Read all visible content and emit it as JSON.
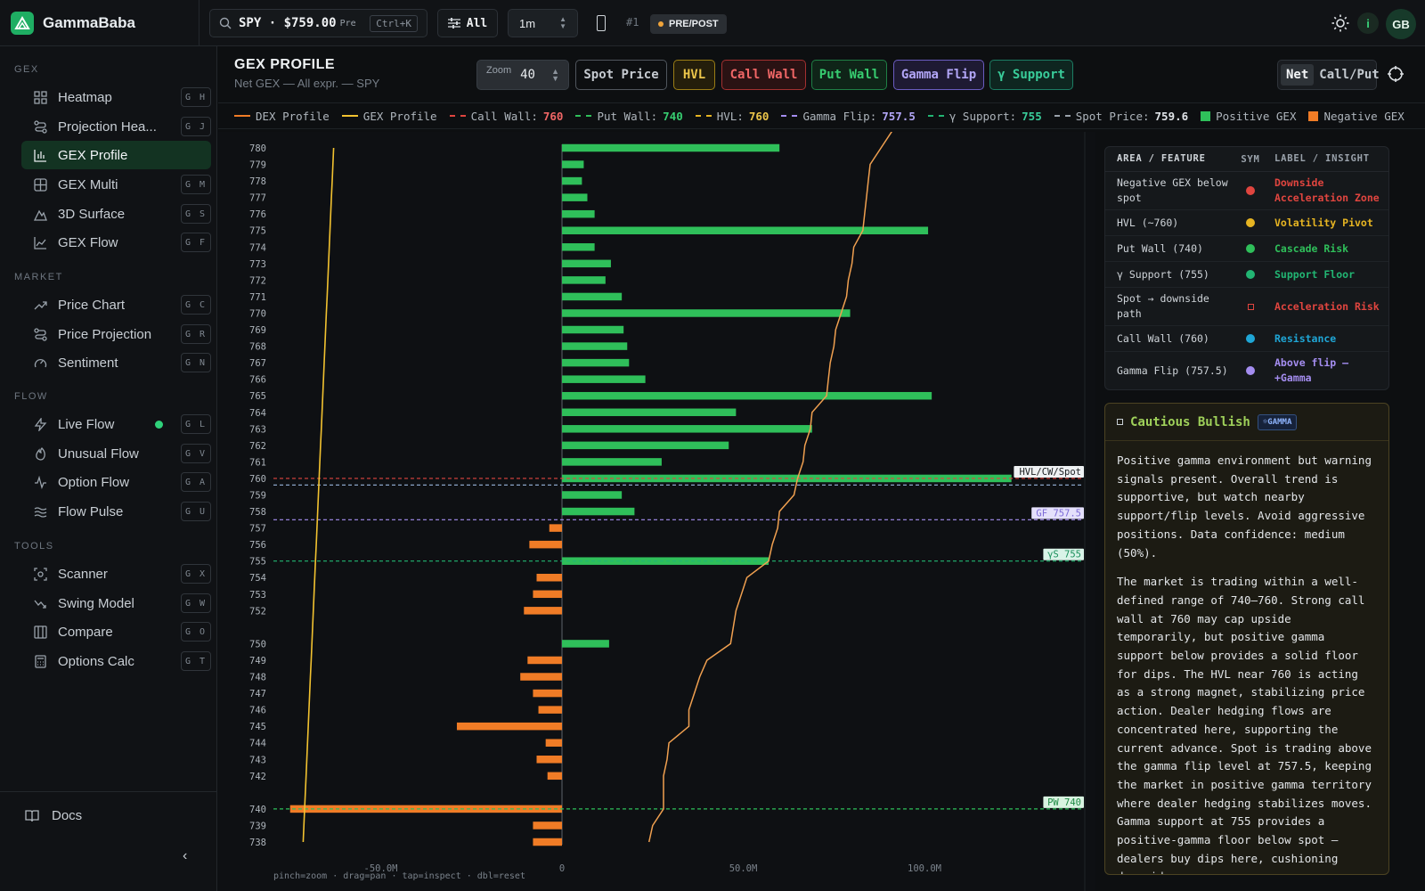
{
  "app": {
    "name": "GammaBaba"
  },
  "topbar": {
    "ticker_text": "SPY · $759.00",
    "ticker_tag": "Pre",
    "search_shortcut": "Ctrl+K",
    "filter_label": "All",
    "interval": "1m",
    "sequence": "#1",
    "session_badge": "PRE/POST",
    "info_label": "i",
    "avatar_initials": "GB"
  },
  "sidebar": {
    "sections": [
      {
        "title": "GEX",
        "items": [
          {
            "label": "Heatmap",
            "shortcut": "G H",
            "icon": "grid-icon"
          },
          {
            "label": "Projection Hea...",
            "shortcut": "G J",
            "icon": "projection-icon"
          },
          {
            "label": "GEX Profile",
            "shortcut": "",
            "icon": "bar-chart-icon",
            "active": true
          },
          {
            "label": "GEX Multi",
            "shortcut": "G M",
            "icon": "grid-plus-icon"
          },
          {
            "label": "3D Surface",
            "shortcut": "G S",
            "icon": "mountain-icon"
          },
          {
            "label": "GEX Flow",
            "shortcut": "G F",
            "icon": "line-chart-icon"
          }
        ]
      },
      {
        "title": "MARKET",
        "items": [
          {
            "label": "Price Chart",
            "shortcut": "G C",
            "icon": "trending-icon"
          },
          {
            "label": "Price Projection",
            "shortcut": "G R",
            "icon": "projection-icon"
          },
          {
            "label": "Sentiment",
            "shortcut": "G N",
            "icon": "gauge-icon"
          }
        ]
      },
      {
        "title": "FLOW",
        "items": [
          {
            "label": "Live Flow",
            "shortcut": "G L",
            "icon": "bolt-icon",
            "live": true
          },
          {
            "label": "Unusual Flow",
            "shortcut": "G V",
            "icon": "flame-icon"
          },
          {
            "label": "Option Flow",
            "shortcut": "G A",
            "icon": "pulse-icon"
          },
          {
            "label": "Flow Pulse",
            "shortcut": "G U",
            "icon": "waves-icon"
          }
        ]
      },
      {
        "title": "TOOLS",
        "items": [
          {
            "label": "Scanner",
            "shortcut": "G X",
            "icon": "scan-icon"
          },
          {
            "label": "Swing Model",
            "shortcut": "G W",
            "icon": "swing-icon"
          },
          {
            "label": "Compare",
            "shortcut": "G O",
            "icon": "columns-icon"
          },
          {
            "label": "Options Calc",
            "shortcut": "G T",
            "icon": "calculator-icon"
          }
        ]
      }
    ],
    "docs_label": "Docs"
  },
  "header": {
    "title": "GEX PROFILE",
    "subtitle": "Net GEX — All expr. — SPY",
    "zoom_label": "Zoom",
    "zoom_value": "40",
    "toggles": {
      "spot": "Spot Price",
      "hvl": "HVL",
      "call_wall": "Call Wall",
      "put_wall": "Put Wall",
      "gamma_flip": "Gamma Flip",
      "gamma_support": "γ Support"
    },
    "mode_on": "Net",
    "mode_off": "Call/Put"
  },
  "legend": {
    "dex": "DEX Profile",
    "gex": "GEX Profile",
    "call_wall": "Call Wall:",
    "call_wall_val": "760",
    "put_wall": "Put Wall:",
    "put_wall_val": "740",
    "hvl": "HVL:",
    "hvl_val": "760",
    "gamma_flip": "Gamma Flip:",
    "gamma_flip_val": "757.5",
    "gamma_support": "γ Support:",
    "gamma_support_val": "755",
    "spot": "Spot Price:",
    "spot_val": "759.6",
    "pos": "Positive GEX",
    "neg": "Negative GEX"
  },
  "chart_data": {
    "type": "bar",
    "orientation": "horizontal",
    "x_ticks": [
      "-50.0M",
      "0",
      "50.0M",
      "100.0M"
    ],
    "xlim": [
      -75,
      140
    ],
    "y_unit": "strike",
    "strikes": [
      780,
      779,
      778,
      777,
      776,
      775,
      774,
      773,
      772,
      771,
      770,
      769,
      768,
      767,
      766,
      765,
      764,
      763,
      762,
      761,
      760,
      759,
      758,
      757,
      756,
      755,
      754,
      753,
      752,
      750,
      749,
      748,
      747,
      746,
      745,
      744,
      743,
      742,
      740,
      739,
      738
    ],
    "net_gex_m": [
      60,
      6,
      5.5,
      7,
      9,
      101,
      9,
      13.5,
      12,
      16.5,
      79.5,
      17,
      18,
      18.5,
      23,
      102,
      48,
      69,
      46,
      27.5,
      124,
      16.5,
      20,
      -3.5,
      -9,
      57,
      -7,
      -8,
      -10.5,
      13,
      -9.5,
      -11.5,
      -8,
      -6.5,
      -29,
      -4.5,
      -7,
      -4,
      -75,
      -8,
      -8
    ],
    "dex_profile_m": [
      -63,
      -63.2,
      -63.4,
      -63.6,
      -63.8,
      -64,
      -64.2,
      -64.4,
      -64.6,
      -64.8,
      -65,
      -65.2,
      -65.4,
      -65.6,
      -65.8,
      -66,
      -66.2,
      -66.4,
      -66.6,
      -66.8,
      -67,
      -67.2,
      -67.4,
      -67.6,
      -67.8,
      -68,
      -68.2,
      -68.4,
      -68.6,
      -69,
      -69.2,
      -69.4,
      -69.6,
      -69.8,
      -70,
      -70.2,
      -70.4,
      -70.6,
      -71,
      -71.2,
      -71.4
    ],
    "gex_cumulative_m": [
      88,
      85,
      84.5,
      84,
      83.5,
      83,
      80.5,
      80,
      79,
      78.5,
      77,
      75.5,
      75,
      74,
      73.5,
      73,
      69,
      68.5,
      67,
      66.5,
      65,
      64,
      60,
      59.5,
      58,
      57,
      51,
      49.5,
      48,
      46.5,
      40,
      38,
      36.5,
      35,
      35,
      29.5,
      29,
      28,
      28,
      25,
      24
    ],
    "gex_top_strike": 781,
    "levels": [
      {
        "name": "HVL/CW/Spot",
        "value": 760
      },
      {
        "name": "Spot Price",
        "value": 759.6
      },
      {
        "name": "GF 757.5",
        "value": 757.5
      },
      {
        "name": "γS 755",
        "value": 755
      },
      {
        "name": "PW 740",
        "value": 740
      }
    ],
    "colors": {
      "positive": "#2fbf5a",
      "negative": "#f07c26",
      "dex": "#f2c230",
      "gex": "#f0a050"
    }
  },
  "chart_hint": "pinch=zoom · drag=pan · tap=inspect · dbl=reset",
  "features": {
    "headers": [
      "AREA / FEATURE",
      "SYM",
      "LABEL / INSIGHT"
    ],
    "rows": [
      {
        "area": "Negative GEX below spot",
        "sym": "dot",
        "color": "#e0453f",
        "label": "Downside Acceleration Zone"
      },
      {
        "area": "HVL (~760)",
        "sym": "dot",
        "color": "#e6b422",
        "label": "Volatility Pivot"
      },
      {
        "area": "Put Wall (740)",
        "sym": "dot",
        "color": "#2fbf5a",
        "label": "Cascade Risk"
      },
      {
        "area": "γ Support (755)",
        "sym": "dot",
        "color": "#22b573",
        "label": "Support Floor"
      },
      {
        "area": "Spot → downside path",
        "sym": "square",
        "color": "#e0453f",
        "label": "Acceleration Risk"
      },
      {
        "area": "Call Wall (760)",
        "sym": "dot",
        "color": "#1fa6d6",
        "label": "Resistance"
      },
      {
        "area": "Gamma Flip (757.5)",
        "sym": "dot",
        "color": "#a48df0",
        "label": "Above flip — +Gamma"
      }
    ]
  },
  "insight": {
    "title": "Cautious Bullish",
    "badge": "☼GAMMA",
    "p1": "Positive gamma environment but warning signals present. Overall trend is supportive, but watch nearby support/flip levels. Avoid aggressive positions. Data confidence: medium (50%).",
    "p2": "The market is trading within a well-defined range of 740–760. Strong call wall at 760 may cap upside temporarily, but positive gamma support below provides a solid floor for dips. The HVL near 760 is acting as a strong magnet, stabilizing price action. Dealer hedging flows are concentrated here, supporting the current advance. Spot is trading above the gamma flip level at 757.5, keeping the market in positive gamma territory where dealer hedging stabilizes moves. Gamma support at 755 provides a positive-gamma floor below spot — dealers buy dips here, cushioning downside."
  }
}
